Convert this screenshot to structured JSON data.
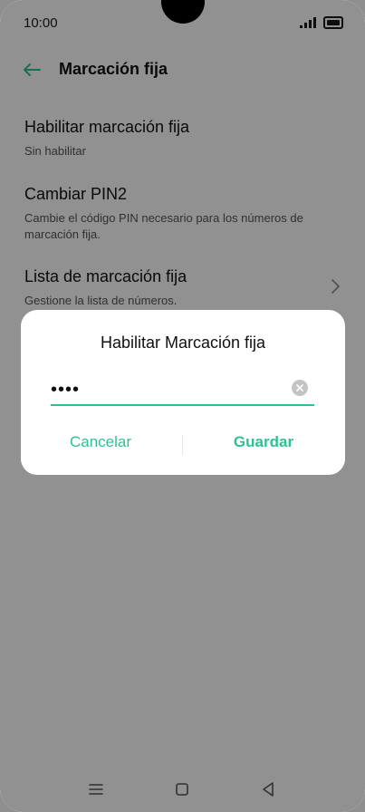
{
  "status_bar": {
    "time": "10:00"
  },
  "header": {
    "title": "Marcación fija"
  },
  "settings": [
    {
      "title": "Habilitar marcación fija",
      "subtitle": "Sin habilitar"
    },
    {
      "title": "Cambiar PIN2",
      "subtitle": "Cambie el código PIN necesario para los números de marcación fija."
    },
    {
      "title": "Lista de marcación fija",
      "subtitle": "Gestione la lista de números."
    }
  ],
  "dialog": {
    "title": "Habilitar Marcación fija",
    "pin_value": "••••",
    "cancel_label": "Cancelar",
    "save_label": "Guardar"
  },
  "colors": {
    "accent": "#2fc192",
    "overlay": "rgba(0,0,0,0.43)"
  },
  "icons": [
    "back-arrow-icon",
    "chevron-right-icon",
    "clear-icon",
    "menu-icon",
    "home-icon",
    "back-triangle-icon"
  ]
}
